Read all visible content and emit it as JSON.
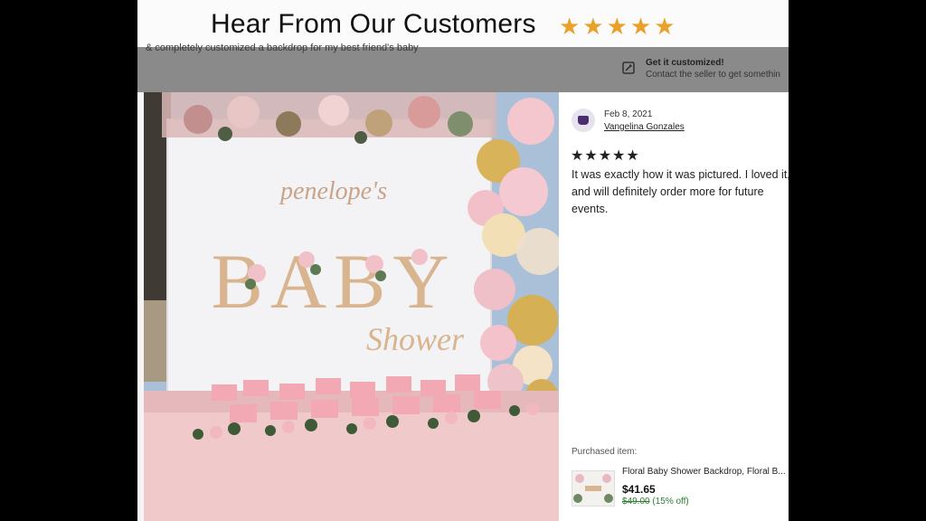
{
  "header": {
    "title": "Hear From Our Customers",
    "stars": "★★★★★"
  },
  "overlay": {
    "snippet": "& completely customized a backdrop for my best friend's baby",
    "customize_title": "Get it customized!",
    "customize_subtitle": "Contact the seller to get somethin"
  },
  "photo": {
    "backdrop_name": "penelope's",
    "backdrop_baby": "BABY",
    "backdrop_shower": "Shower"
  },
  "review": {
    "date": "Feb 8, 2021",
    "reviewer": "Vangelina Gonzales",
    "stars": "★★★★★",
    "text": "It was exactly how it was pictured. I loved it, and will definitely order more for future events."
  },
  "purchase": {
    "label": "Purchased item:",
    "title": "Floral Baby Shower Backdrop, Floral B...",
    "price": "$41.65",
    "original_price": "$49.00",
    "discount": "(15% off)"
  },
  "colors": {
    "accent_star": "#e9a12a",
    "discount_green": "#2e7d32",
    "avatar_purple": "#4a2d6e"
  }
}
